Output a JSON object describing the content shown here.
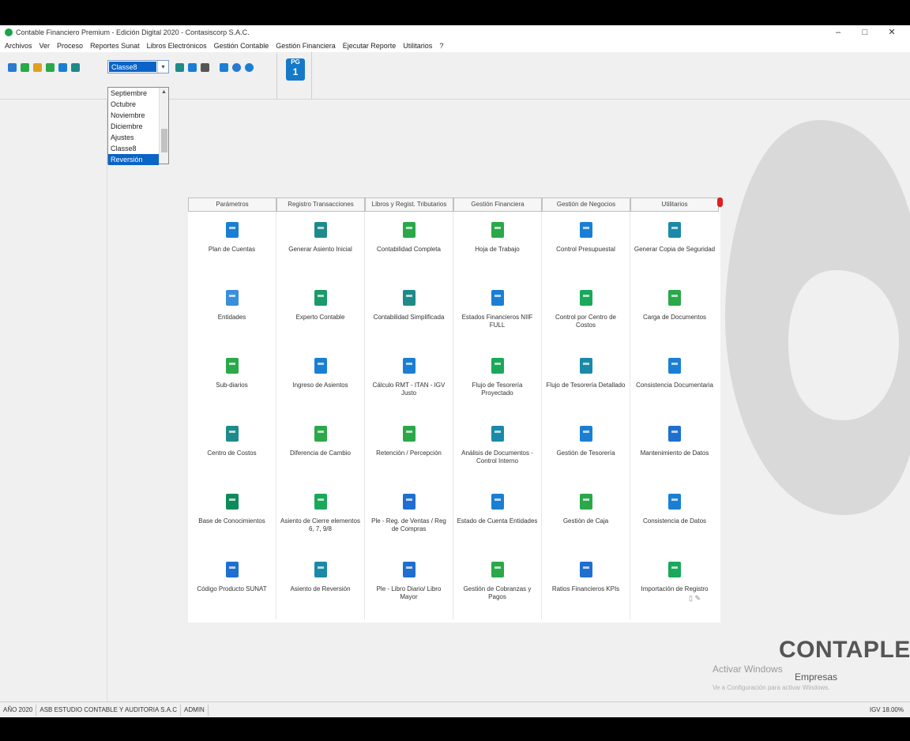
{
  "window": {
    "title": "Contable Financiero Premium - Edición Digital 2020 - Contasiscorp S.A.C.",
    "minimize": "–",
    "maximize": "□",
    "close": "✕"
  },
  "menu": [
    "Archivos",
    "Ver",
    "Proceso",
    "Reportes Sunat",
    "Libros Electrónicos",
    "Gestión Contable",
    "Gestión Financiera",
    "Ejecutar Reporte",
    "Utilitarios",
    "?"
  ],
  "toolbar": {
    "period_value": "Classe8",
    "pg_top": "PG",
    "pg_num": "1"
  },
  "dropdown": {
    "options": [
      "Septiembre",
      "Octubre",
      "Noviembre",
      "Diciembre",
      "Ajustes",
      "Classe8",
      "Reversión"
    ],
    "selected_index": 6
  },
  "tabs": [
    "Parámetros",
    "Registro Transacciones",
    "Libros y Regist. Tributarios",
    "Gestión Financiera",
    "Gestión de Negocios",
    "Utilitarios"
  ],
  "columns": [
    [
      {
        "label": "Plan de Cuentas",
        "icon": "document-icon",
        "color": "#1a7fd4"
      },
      {
        "label": "Entidades",
        "icon": "people-icon",
        "color": "#3a8fd9"
      },
      {
        "label": "Sub-diarios",
        "icon": "diary-icon",
        "color": "#2aa84a"
      },
      {
        "label": "Centro de Costos",
        "icon": "hub-icon",
        "color": "#1f8a8a"
      },
      {
        "label": "Base de Conocimientos",
        "icon": "head-icon",
        "color": "#0f8a5a"
      },
      {
        "label": "Código Producto SUNAT",
        "icon": "code-icon",
        "color": "#1e6fd0"
      }
    ],
    [
      {
        "label": "Generar Asiento Inicial",
        "icon": "list-arrow-icon",
        "color": "#1f8a8a"
      },
      {
        "label": "Experto Contable",
        "icon": "expert-icon",
        "color": "#1a9a6a"
      },
      {
        "label": "Ingreso de Asientos",
        "icon": "entry-icon",
        "color": "#1a7fd4"
      },
      {
        "label": "Diferencia de Cambio",
        "icon": "exchange-icon",
        "color": "#2aa84a"
      },
      {
        "label": "Asiento de Cierre elementos 6, 7, 9/8",
        "icon": "close-entry-icon",
        "color": "#1aa85a"
      },
      {
        "label": "Asiento de Reversión",
        "icon": "reverse-icon",
        "color": "#1a8aa8"
      }
    ],
    [
      {
        "label": "Contabilidad Completa",
        "icon": "bar-chart-icon",
        "color": "#2aa84a"
      },
      {
        "label": "Contabilidad Simplificada",
        "icon": "chart-simple-icon",
        "color": "#1f8a8a"
      },
      {
        "label": "Cálculo RMT - ITAN - IGV Justo",
        "icon": "calc-icon",
        "color": "#1a7fd4"
      },
      {
        "label": "Retención / Percepción",
        "icon": "retention-icon",
        "color": "#2aa84a"
      },
      {
        "label": "Ple - Reg. de Ventas / Reg de Compras",
        "icon": "ple-icon",
        "color": "#1e6fd0"
      },
      {
        "label": "Ple - Libro Diario/ Libro Mayor",
        "icon": "ple-book-icon",
        "color": "#1e6fd0"
      }
    ],
    [
      {
        "label": "Hoja de Trabajo",
        "icon": "spreadsheet-icon",
        "color": "#2aa84a"
      },
      {
        "label": "Estados Financieros NIIF FULL",
        "icon": "statements-icon",
        "color": "#1a7fd4"
      },
      {
        "label": "Flujo de Tesorería Proyectado",
        "icon": "cashflow-icon",
        "color": "#1aa85a"
      },
      {
        "label": "Análisis de Documentos - Control Interno",
        "icon": "analysis-icon",
        "color": "#1a8aa8"
      },
      {
        "label": "Estado de Cuenta Entidades",
        "icon": "account-icon",
        "color": "#1a7fd4"
      },
      {
        "label": "Gestión de Cobranzas y Pagos",
        "icon": "collections-icon",
        "color": "#2aa84a"
      }
    ],
    [
      {
        "label": "Control Presupuestal",
        "icon": "calendar-icon",
        "color": "#1a7fd4"
      },
      {
        "label": "Control por Centro de Costos",
        "icon": "network-icon",
        "color": "#1aa85a"
      },
      {
        "label": "Flujo de Tesorería Detallado",
        "icon": "money-list-icon",
        "color": "#1a8aa8"
      },
      {
        "label": "Gestión de Tesorería",
        "icon": "treasury-icon",
        "color": "#1a7fd4"
      },
      {
        "label": "Gestión de Caja",
        "icon": "cash-icon",
        "color": "#2aa84a"
      },
      {
        "label": "Ratios Financieros KPIs",
        "icon": "kpi-icon",
        "color": "#1e6fd0"
      }
    ],
    [
      {
        "label": "Generar Copia de Seguridad",
        "icon": "backup-icon",
        "color": "#1a8aa8"
      },
      {
        "label": "Carga de Documentos",
        "icon": "reload-icon",
        "color": "#2aa84a"
      },
      {
        "label": "Consistencia Documentaria",
        "icon": "consistency-icon",
        "color": "#1a7fd4"
      },
      {
        "label": "Mantenimiento de Datos",
        "icon": "maintenance-icon",
        "color": "#1e6fd0"
      },
      {
        "label": "Consistencia de Datos",
        "icon": "data-icon",
        "color": "#1a7fd4"
      },
      {
        "label": "Importación de Registro",
        "icon": "import-icon",
        "color": "#1aa85a"
      }
    ]
  ],
  "branding": {
    "name": "CONTAPLE",
    "sub": "Empresas",
    "activate": "Activar Windows",
    "activate_hint": "Ve a Configuración para activar Windows."
  },
  "status": {
    "year": "AÑO 2020",
    "company": "ASB ESTUDIO CONTABLE Y AUDITORIA S.A.C",
    "user": "ADMIN",
    "igv": "IGV 18.00%"
  }
}
